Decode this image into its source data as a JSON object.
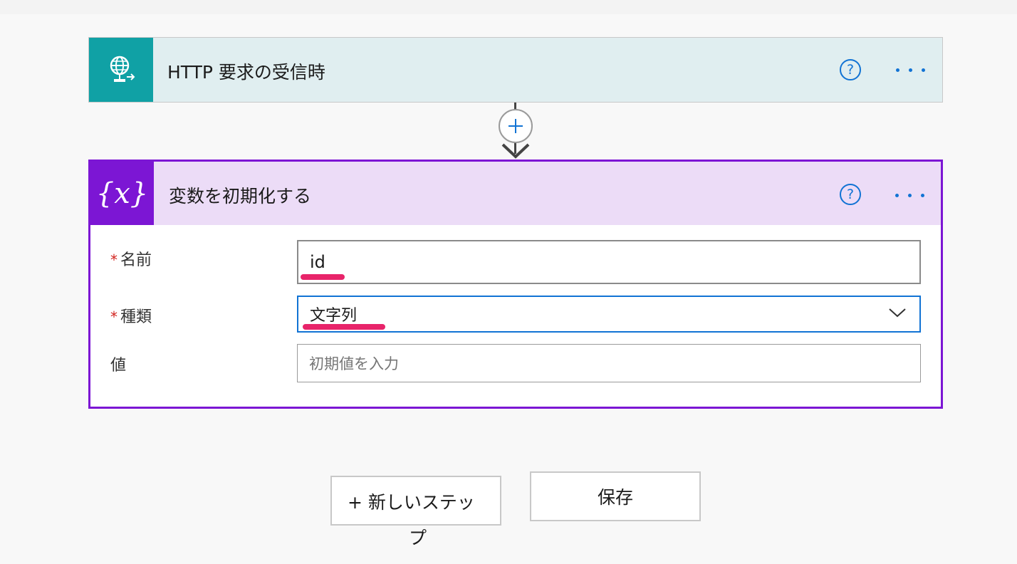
{
  "trigger": {
    "icon": "globe-request-icon",
    "title": "HTTP 要求の受信時",
    "help": "?",
    "more": "more-options-icon"
  },
  "connector": {
    "add_icon": "plus-icon",
    "arrow": "arrow-down-icon"
  },
  "init_var": {
    "icon_text": "{x}",
    "title": "変数を初期化する",
    "help": "?",
    "fields": {
      "name": {
        "required_mark": "*",
        "label": "名前",
        "value": "id"
      },
      "type": {
        "required_mark": "*",
        "label": "種類",
        "value": "文字列",
        "dropdown_icon": "chevron-down-icon"
      },
      "value": {
        "label": "値",
        "placeholder": "初期値を入力"
      }
    }
  },
  "actions": {
    "new_step_line1": "+ 新しいステッ",
    "new_step_line2": "プ",
    "save": "保存"
  },
  "colors": {
    "trigger_accent": "#10a1a5",
    "trigger_bg": "#e0eef0",
    "variable_accent": "#7c16d4",
    "variable_bg": "#ecdcf7",
    "link_blue": "#1173d4",
    "annotation": "#e8246a"
  }
}
